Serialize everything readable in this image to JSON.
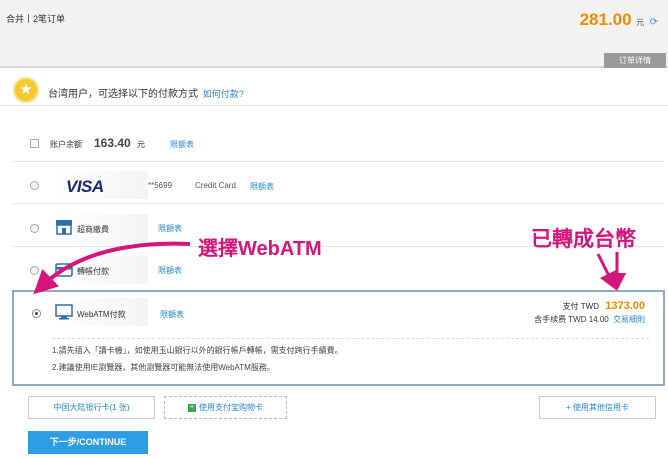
{
  "header": {
    "order_title": "合并丨2笔订单",
    "total_amount": "281.00",
    "total_unit": "元",
    "order_detail_tab": "订单详情"
  },
  "notice": {
    "text": "台湾用户，可选择以下的付款方式",
    "link": "如何付款?"
  },
  "options": {
    "balance": {
      "label": "账户余额",
      "amount": "163.40",
      "unit": "元",
      "limit_link": "限额表"
    },
    "visa": {
      "brand": "VISA",
      "card_mask": "**5699",
      "type": "Credit Card",
      "limit_link": "限额表"
    },
    "store": {
      "label": "超商繳費",
      "limit_link": "限額表"
    },
    "transfer": {
      "label": "轉帳付款",
      "limit_link": "限額表"
    },
    "webatm": {
      "label": "WebATM付款",
      "limit_link": "限額表",
      "pay_label": "支付 TWD",
      "pay_amount": "1373.00",
      "fee_label": "含手续费 TWD 14.00",
      "fee_link": "交易細則",
      "note1": "1.請先插入「讀卡機」，如使用玉山銀行以外的銀行帳戶轉帳，需支付跨行手續費。",
      "note2": "2.建議使用IE瀏覽器，其他瀏覽器可能無法使用WebATM服務。"
    }
  },
  "annotations": {
    "select_webatm": "選擇WebATM",
    "converted": "已轉成台幣"
  },
  "buttons": {
    "cn_card": "中国大陆银行卡(1 张)",
    "alipay_card": "使用支付宝购物卡",
    "other_card": "+ 使用其他信用卡",
    "continue": "下一步/CONTINUE"
  },
  "colors": {
    "accent_orange": "#f08a00",
    "link_blue": "#2a87c8",
    "annotation_magenta": "#d6157a",
    "continue_blue": "#2c9ee6"
  }
}
